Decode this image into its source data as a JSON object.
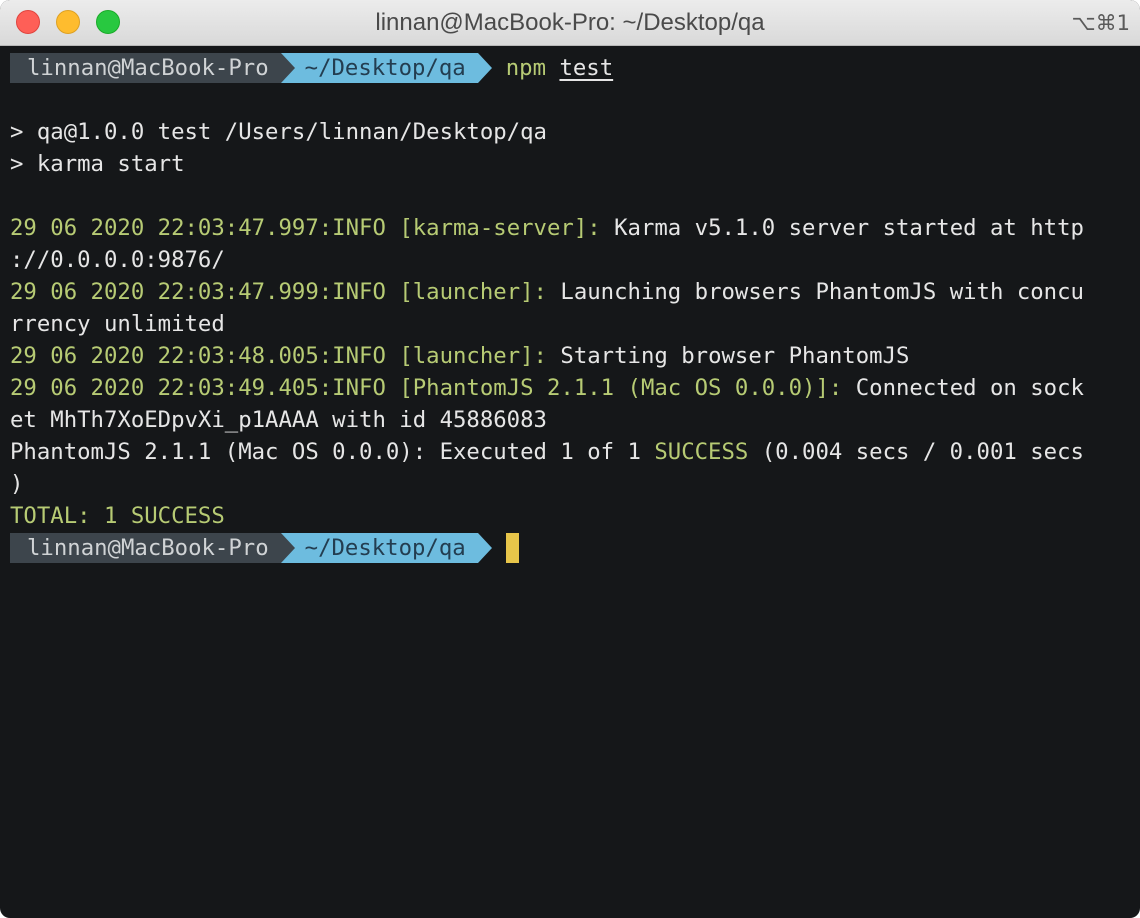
{
  "window": {
    "title": "linnan@MacBook-Pro: ~/Desktop/qa",
    "shortcut": "⌥⌘1"
  },
  "colors": {
    "background": "#151719",
    "text": "#e6e6e6",
    "green": "#b7cb74",
    "prompt_user_bg": "#3d454c",
    "prompt_dir_bg": "#6dbcdf",
    "cursor": "#e7c54a"
  },
  "prompt": {
    "user": "linnan@MacBook-Pro",
    "dir": "~/Desktop/qa"
  },
  "command": {
    "program": "npm",
    "arg": "test"
  },
  "lines": [
    {
      "plain": "> qa@1.0.0 test /Users/linnan/Desktop/qa"
    },
    {
      "plain": "> karma start"
    },
    {
      "timestamp": "29 06 2020 22:03:47.997:INFO",
      "tag": "[karma-server]:",
      "message": " Karma v5.1.0 server started at http",
      "continuation": "://0.0.0.0:9876/"
    },
    {
      "timestamp": "29 06 2020 22:03:47.999:INFO",
      "tag": "[launcher]:",
      "message": " Launching browsers PhantomJS with concu",
      "continuation": "rrency unlimited"
    },
    {
      "timestamp": "29 06 2020 22:03:48.005:INFO",
      "tag": "[launcher]:",
      "message": " Starting browser PhantomJS"
    },
    {
      "timestamp": "29 06 2020 22:03:49.405:INFO",
      "tag": "[PhantomJS 2.1.1 (Mac OS 0.0.0)]:",
      "message": " Connected on sock",
      "continuation": "et MhTh7XoEDpvXi_p1AAAA with id 45886083"
    },
    {
      "pre": "PhantomJS 2.1.1 (Mac OS 0.0.0): Executed 1 of 1 ",
      "status": "SUCCESS",
      "post": " (0.004 secs / 0.001 secs",
      "continuation": ")"
    },
    {
      "total": "TOTAL: 1 SUCCESS"
    }
  ]
}
